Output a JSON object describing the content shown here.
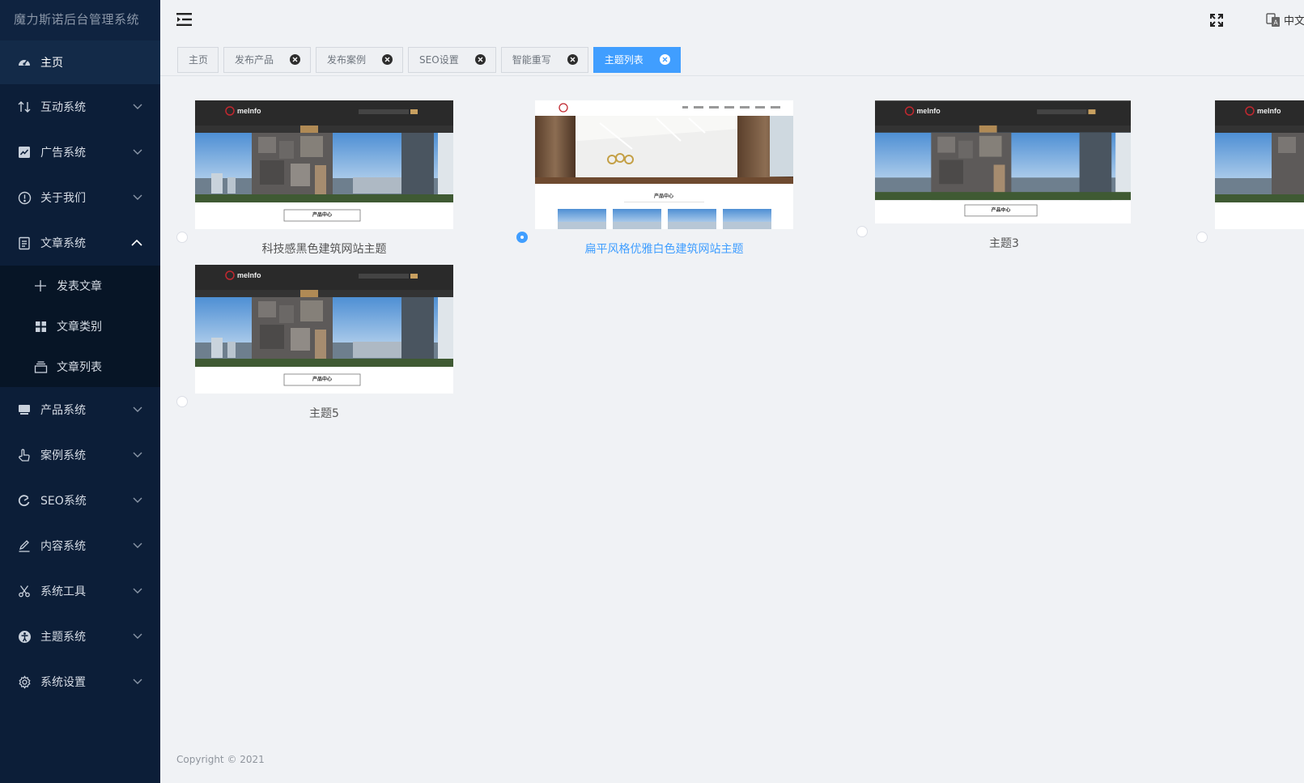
{
  "app": {
    "title": "魔力斯诺后台管理系统"
  },
  "sidebar": {
    "items": [
      {
        "label": "主页",
        "icon": "dashboard-icon",
        "active": true
      },
      {
        "label": "互动系统",
        "icon": "interaction-icon"
      },
      {
        "label": "广告系统",
        "icon": "chart-icon"
      },
      {
        "label": "关于我们",
        "icon": "info-icon"
      },
      {
        "label": "文章系统",
        "icon": "document-icon",
        "expanded": true
      },
      {
        "label": "产品系统",
        "icon": "product-icon"
      },
      {
        "label": "案例系统",
        "icon": "hand-icon"
      },
      {
        "label": "SEO系统",
        "icon": "seo-icon"
      },
      {
        "label": "内容系统",
        "icon": "edit-icon"
      },
      {
        "label": "系统工具",
        "icon": "scissors-icon"
      },
      {
        "label": "主题系统",
        "icon": "theme-icon"
      },
      {
        "label": "系统设置",
        "icon": "gear-icon"
      }
    ],
    "article_submenu": [
      {
        "label": "发表文章",
        "icon": "plus-icon"
      },
      {
        "label": "文章类别",
        "icon": "grid-icon"
      },
      {
        "label": "文章列表",
        "icon": "stack-icon"
      }
    ]
  },
  "header": {
    "language": "中文"
  },
  "tabs": [
    {
      "label": "主页",
      "closable": false,
      "active": false
    },
    {
      "label": "发布产品",
      "closable": true,
      "active": false
    },
    {
      "label": "发布案例",
      "closable": true,
      "active": false
    },
    {
      "label": "SEO设置",
      "closable": true,
      "active": false
    },
    {
      "label": "智能重写",
      "closable": true,
      "active": false
    },
    {
      "label": "主题列表",
      "closable": true,
      "active": true
    }
  ],
  "themes": [
    {
      "name": "科技感黑色建筑网站主题",
      "style": "dark",
      "selected": false
    },
    {
      "name": "扁平风格优雅白色建筑网站主题",
      "style": "white",
      "selected": true
    },
    {
      "name": "主题3",
      "style": "dark",
      "selected": false
    },
    {
      "name": "",
      "style": "dark",
      "selected": false
    },
    {
      "name": "主题5",
      "style": "dark",
      "selected": false
    }
  ],
  "thumbnail": {
    "logo_text": "meInfo",
    "section_title": "产品中心"
  },
  "colors": {
    "sidebar": "#0c1e38",
    "accent": "#409eff",
    "background": "#f0f2f5"
  },
  "footer": {
    "copyright": "Copyright © 2021"
  }
}
